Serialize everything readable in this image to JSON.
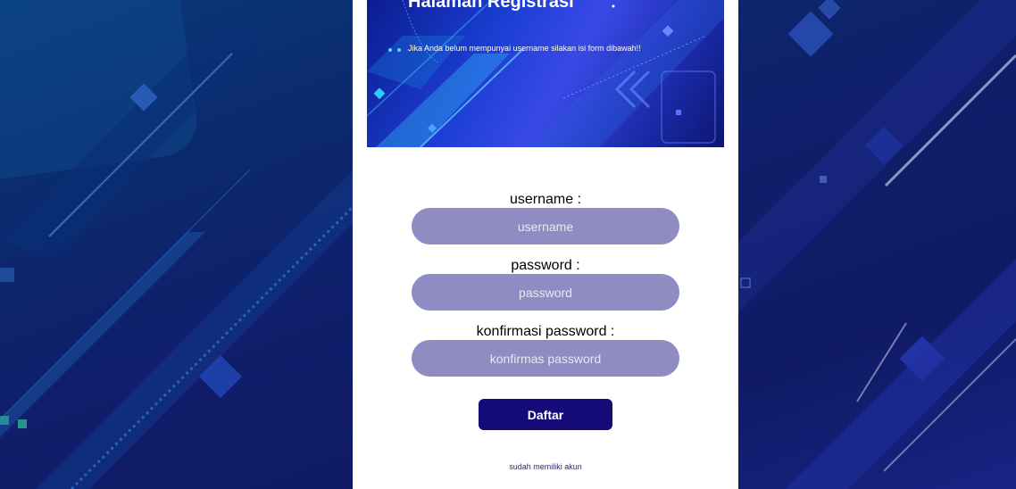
{
  "banner": {
    "title": "Halaman Registrasi",
    "subtitle": "Jika Anda belum mempunyai username silakan isi form dibawah!!"
  },
  "form": {
    "username": {
      "label": "username :",
      "placeholder": "username"
    },
    "password": {
      "label": "password :",
      "placeholder": "password"
    },
    "confirm": {
      "label": "konfirmasi password :",
      "placeholder": "konfirmas password"
    },
    "submit_label": "Daftar"
  },
  "login_link": "sudah memiliki akun",
  "colors": {
    "input_bg": "#8f8bc3",
    "button_bg": "#140a78",
    "page_bg": "#101e6b"
  }
}
